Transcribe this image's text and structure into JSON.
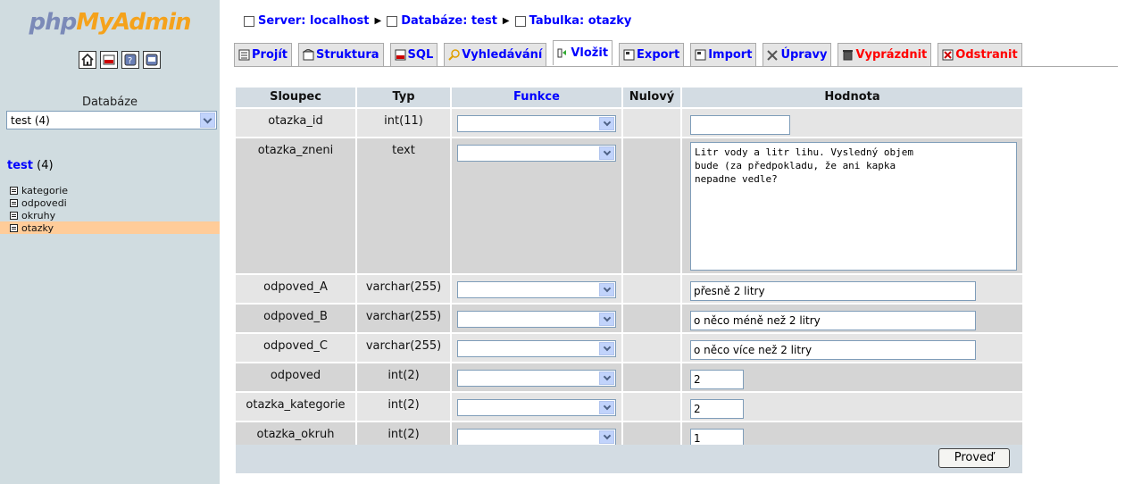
{
  "left": {
    "logo_php": "php",
    "logo_myadmin": "MyAdmin",
    "icons": [
      "home-icon",
      "sql-icon",
      "help-icon",
      "query-window-icon"
    ],
    "db_label": "Databáze",
    "db_select_value": "test (4)",
    "db_link_name": "test",
    "db_link_count": "(4)",
    "tables": [
      "kategorie",
      "odpovedi",
      "okruhy",
      "otazky"
    ],
    "selected_table": "otazky"
  },
  "breadcrumb": {
    "server": "Server: localhost",
    "database": "Databáze: test",
    "table": "Tabulka: otazky"
  },
  "tabs": [
    {
      "label": "Projít",
      "icon": "browse-icon"
    },
    {
      "label": "Struktura",
      "icon": "structure-icon"
    },
    {
      "label": "SQL",
      "icon": "sql-icon"
    },
    {
      "label": "Vyhledávání",
      "icon": "search-icon"
    },
    {
      "label": "Vložit",
      "icon": "insert-icon",
      "active": true
    },
    {
      "label": "Export",
      "icon": "export-icon"
    },
    {
      "label": "Import",
      "icon": "import-icon"
    },
    {
      "label": "Úpravy",
      "icon": "operations-icon"
    },
    {
      "label": "Vyprázdnit",
      "icon": "empty-icon",
      "danger": true
    },
    {
      "label": "Odstranit",
      "icon": "drop-icon",
      "danger": true
    }
  ],
  "form": {
    "headers": {
      "column": "Sloupec",
      "type": "Typ",
      "function": "Funkce",
      "null": "Nulový",
      "value": "Hodnota"
    },
    "rows": [
      {
        "name": "otazka_id",
        "type": "int(11)",
        "function": "",
        "value": ""
      },
      {
        "name": "otazka_zneni",
        "type": "text",
        "function": "",
        "value": "Litr vody a litr lihu. Vysledný objem\nbude (za předpokladu, že ani kapka\nnepadne vedle?"
      },
      {
        "name": "odpoved_A",
        "type": "varchar(255)",
        "function": "",
        "value": "přesně 2 litry"
      },
      {
        "name": "odpoved_B",
        "type": "varchar(255)",
        "function": "",
        "value": "o něco méně než 2 litry"
      },
      {
        "name": "odpoved_C",
        "type": "varchar(255)",
        "function": "",
        "value": "o něco více než 2 litry"
      },
      {
        "name": "odpoved",
        "type": "int(2)",
        "function": "",
        "value": "2"
      },
      {
        "name": "otazka_kategorie",
        "type": "int(2)",
        "function": "",
        "value": "2"
      },
      {
        "name": "otazka_okruh",
        "type": "int(2)",
        "function": "",
        "value": "1"
      }
    ],
    "submit_label": "Proveď"
  },
  "colors": {
    "left_bg": "#d0dce0",
    "header_bg": "#d3dce3",
    "row_light": "#e5e5e5",
    "row_dark": "#d5d5d5",
    "link": "#0000ff",
    "danger": "#ff0000",
    "selected_table_bg": "#ffcc99"
  }
}
